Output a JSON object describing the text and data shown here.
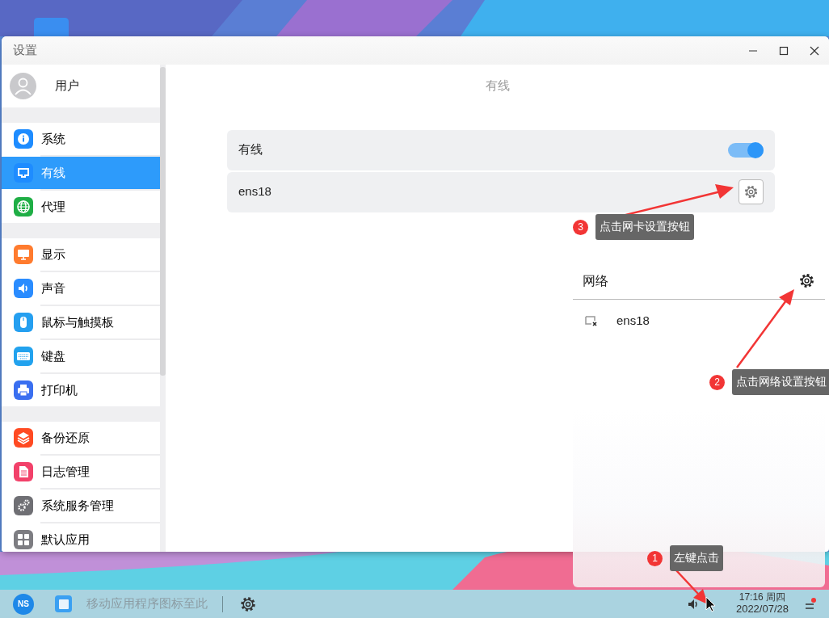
{
  "window": {
    "title": "设置"
  },
  "sidebar": {
    "user": {
      "name": "用户"
    },
    "groups": [
      {
        "items": [
          {
            "label": "系统",
            "color": "#1e8cff",
            "selected": false
          },
          {
            "label": "有线",
            "color": "#1e8cff",
            "selected": true
          },
          {
            "label": "代理",
            "color": "#1fae45",
            "selected": false
          }
        ]
      },
      {
        "items": [
          {
            "label": "显示",
            "color": "#ff7b2e",
            "selected": false
          },
          {
            "label": "声音",
            "color": "#2a8cff",
            "selected": false
          },
          {
            "label": "鼠标与触摸板",
            "color": "#259ff0",
            "selected": false
          },
          {
            "label": "键盘",
            "color": "#22a2ee",
            "selected": false
          },
          {
            "label": "打印机",
            "color": "#3a6ff0",
            "selected": false
          }
        ]
      },
      {
        "items": [
          {
            "label": "备份还原",
            "color": "#ff4a22",
            "selected": false
          },
          {
            "label": "日志管理",
            "color": "#f2416a",
            "selected": false
          },
          {
            "label": "系统服务管理",
            "color": "#6f6f74",
            "selected": false
          },
          {
            "label": "默认应用",
            "color": "#7d7d82",
            "selected": false
          }
        ]
      }
    ]
  },
  "content": {
    "title": "有线",
    "wired_switch": {
      "label": "有线",
      "on": true
    },
    "adapter": {
      "name": "ens18"
    }
  },
  "network_panel": {
    "title": "网络",
    "devices": [
      {
        "name": "ens18"
      }
    ]
  },
  "callouts": [
    {
      "number": "3",
      "text": "点击网卡设置按钮"
    },
    {
      "number": "2",
      "text": "点击网络设置按钮"
    },
    {
      "number": "1",
      "text": "左键点击"
    }
  ],
  "taskbar": {
    "logo": "NS",
    "hint": "移动应用程序图标至此",
    "time": "17:16",
    "weekday": "周四",
    "date": "2022/07/28"
  }
}
